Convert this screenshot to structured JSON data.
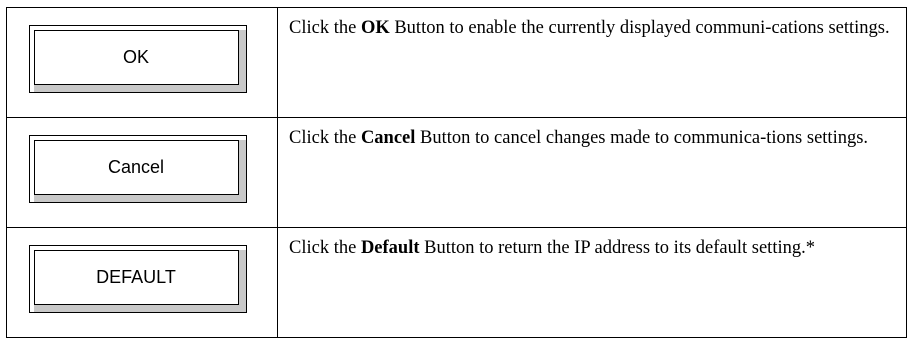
{
  "rows": [
    {
      "button_label": "OK",
      "desc_pre": "Click the ",
      "desc_bold": "OK",
      "desc_post": " Button to enable the currently displayed communi-cations settings."
    },
    {
      "button_label": "Cancel",
      "desc_pre": "Click the ",
      "desc_bold": "Cancel",
      "desc_post": " Button to cancel changes made to communica-tions settings."
    },
    {
      "button_label": "DEFAULT",
      "desc_pre": "Click the ",
      "desc_bold": "Default",
      "desc_post": " Button to return the IP address to its default setting.*"
    }
  ]
}
